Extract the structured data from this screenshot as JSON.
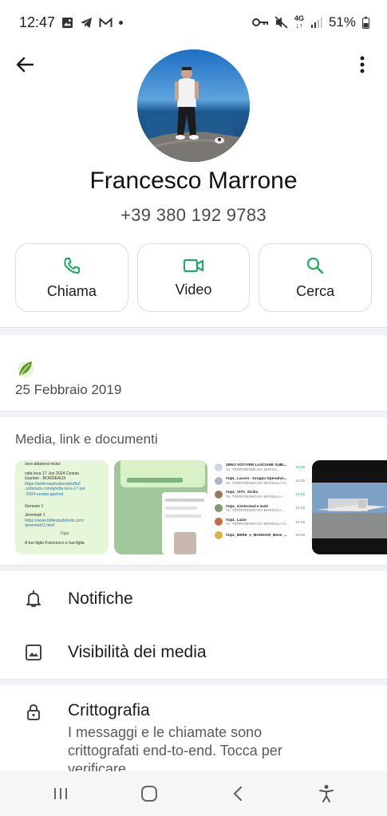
{
  "status_bar": {
    "time": "12:47",
    "net_top": "4G",
    "net_bottom": "↓↑",
    "battery": "51%"
  },
  "contact": {
    "name": "Francesco Marrone",
    "phone": "+39 380 192 9783"
  },
  "actions": [
    {
      "label": "Chiama",
      "icon": "phone-icon"
    },
    {
      "label": "Video",
      "icon": "video-icon"
    },
    {
      "label": "Cerca",
      "icon": "search-icon"
    }
  ],
  "about": {
    "date": "25 Febbraio 2019"
  },
  "media": {
    "title": "Media, link e documenti",
    "thumb1_lines": [
      "/ans-albanesi-victor",
      "vida loca 17 Jun 2024 Cestas",
      "Gazinet - BORDEAUX",
      "https://andreasalvatoresbuffa2",
      ".substack.com/p/vida-loca-17-jun",
      "-2024-cestas-gazinet",
      "Genesis 1",
      "Jeremiah 1",
      "https://www.biblestudytools.com",
      "/jeremiah/1.html",
      "Oggi",
      "A tuo figlio Francesco e tua figlia"
    ],
    "thumb3_rows": [
      {
        "title": "ZERO VOTI PER LASCIARE SUBI...",
        "sub": "Tu: TERRORISMO DA MARSA...",
        "time": "14:46"
      },
      {
        "title": "#UpL_Lavoro - Gruppo Operativo...",
        "sub": "Tu: TERRORISMO DA MARSALA VI...",
        "time": "14:45"
      },
      {
        "title": "#UpL_VITA_Sicilia",
        "sub": "Tu: TERRORISMO DA MARSALA...",
        "time": "14:45"
      },
      {
        "title": "#UpL_CentroSud e Isole",
        "sub": "Tu: TERRORISMO DA MARSALA...",
        "time": "14:46"
      },
      {
        "title": "#UpL_Lazio",
        "sub": "Tu: TERRORISMO DA MARSALA VI...",
        "time": "14:46"
      },
      {
        "title": "#UpL_BERE_e_MANGIAR_Bene_...",
        "sub": "",
        "time": "14:46"
      }
    ]
  },
  "settings": {
    "notifications": "Notifiche",
    "media_visibility": "Visibilità dei media",
    "encryption_title": "Crittografia",
    "encryption_sub": "I messaggi e le chiamate sono crittografati end-to-end. Tocca per verificare."
  },
  "colors": {
    "accent": "#1daa61",
    "text": "#1c1c1c",
    "muted": "#5a5a5a"
  }
}
